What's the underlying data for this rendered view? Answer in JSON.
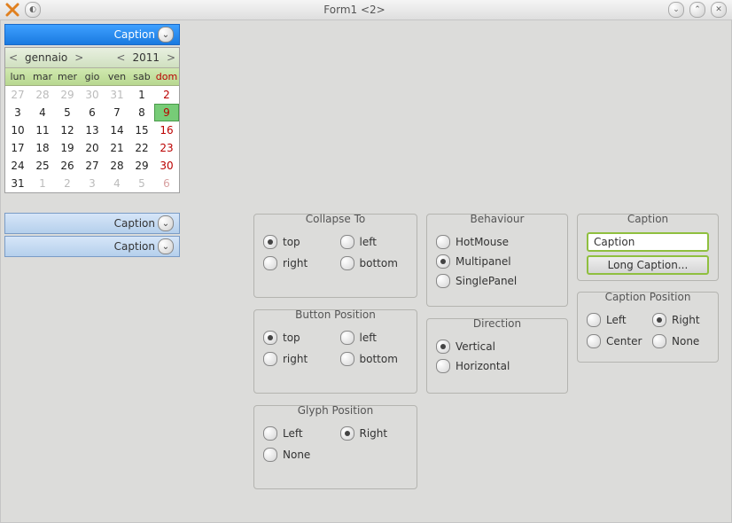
{
  "window": {
    "title": "Form1 <2>"
  },
  "captions": {
    "top": "Caption",
    "mid": "Caption",
    "bot": "Caption"
  },
  "calendar": {
    "month": "gennaio",
    "year": "2011",
    "dow": [
      "lun",
      "mar",
      "mer",
      "gio",
      "ven",
      "sab",
      "dom"
    ],
    "cells": [
      {
        "n": "27",
        "dim": true
      },
      {
        "n": "28",
        "dim": true
      },
      {
        "n": "29",
        "dim": true
      },
      {
        "n": "30",
        "dim": true
      },
      {
        "n": "31",
        "dim": true
      },
      {
        "n": "1"
      },
      {
        "n": "2",
        "sun": true
      },
      {
        "n": "3"
      },
      {
        "n": "4"
      },
      {
        "n": "5"
      },
      {
        "n": "6"
      },
      {
        "n": "7"
      },
      {
        "n": "8"
      },
      {
        "n": "9",
        "sun": true,
        "sel": true
      },
      {
        "n": "10"
      },
      {
        "n": "11"
      },
      {
        "n": "12"
      },
      {
        "n": "13"
      },
      {
        "n": "14"
      },
      {
        "n": "15"
      },
      {
        "n": "16",
        "sun": true
      },
      {
        "n": "17"
      },
      {
        "n": "18"
      },
      {
        "n": "19"
      },
      {
        "n": "20"
      },
      {
        "n": "21"
      },
      {
        "n": "22"
      },
      {
        "n": "23",
        "sun": true
      },
      {
        "n": "24"
      },
      {
        "n": "25"
      },
      {
        "n": "26"
      },
      {
        "n": "27"
      },
      {
        "n": "28"
      },
      {
        "n": "29"
      },
      {
        "n": "30",
        "sun": true
      },
      {
        "n": "31"
      },
      {
        "n": "1",
        "dim": true
      },
      {
        "n": "2",
        "dim": true
      },
      {
        "n": "3",
        "dim": true
      },
      {
        "n": "4",
        "dim": true
      },
      {
        "n": "5",
        "dim": true
      },
      {
        "n": "6",
        "dim": true,
        "sun": true
      }
    ]
  },
  "groups": {
    "collapse_to": {
      "title": "Collapse To",
      "options": {
        "top": "top",
        "left": "left",
        "right": "right",
        "bottom": "bottom"
      },
      "selected": "top"
    },
    "button_position": {
      "title": "Button Position",
      "options": {
        "top": "top",
        "left": "left",
        "right": "right",
        "bottom": "bottom"
      },
      "selected": "top"
    },
    "glyph_position": {
      "title": "Glyph Position",
      "options": {
        "left": "Left",
        "right": "Right",
        "none": "None"
      },
      "selected": "right"
    },
    "behaviour": {
      "title": "Behaviour",
      "options": {
        "hotmouse": "HotMouse",
        "multipanel": "Multipanel",
        "singlepanel": "SinglePanel"
      },
      "selected": "multipanel"
    },
    "direction": {
      "title": "Direction",
      "options": {
        "vertical": "Vertical",
        "horizontal": "Horizontal"
      },
      "selected": "vertical"
    },
    "caption": {
      "title": "Caption",
      "input_value": "Caption",
      "button_label": "Long Caption..."
    },
    "caption_position": {
      "title": "Caption Position",
      "options": {
        "left": "Left",
        "right": "Right",
        "center": "Center",
        "none": "None"
      },
      "selected": "right"
    }
  }
}
